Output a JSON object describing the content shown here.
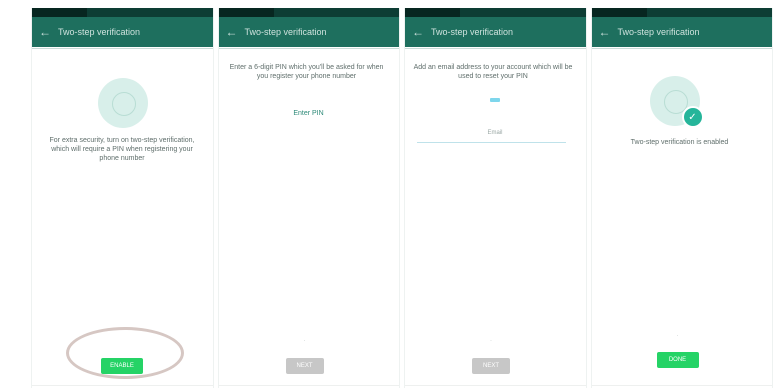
{
  "colors": {
    "header": "#1e6f5e",
    "status_bar": "#0d3d34",
    "accent": "#25d366",
    "teal_badge": "#25b59a",
    "disabled": "#c7c7c7",
    "highlight": "#d6c7c3"
  },
  "screens": [
    {
      "title": "Two-step verification",
      "back_icon": "arrow-left-icon",
      "icon": "lock-icon",
      "description": "For extra security, turn on two-step verification, which will require a PIN when registering your phone number",
      "button": "ENABLE"
    },
    {
      "title": "Two-step verification",
      "back_icon": "arrow-left-icon",
      "description": "Enter a 6-digit PIN which you'll be asked for when you register your phone number",
      "link": "Enter PIN",
      "button": "NEXT"
    },
    {
      "title": "Two-step verification",
      "back_icon": "arrow-left-icon",
      "description": "Add an email address to your account which will be used to reset your PIN",
      "input_value": "",
      "input_hint": "Email",
      "button": "NEXT"
    },
    {
      "title": "Two-step verification",
      "back_icon": "arrow-left-icon",
      "icon": "lock-check-icon",
      "description": "Two-step verification is enabled",
      "button": "DONE"
    }
  ]
}
